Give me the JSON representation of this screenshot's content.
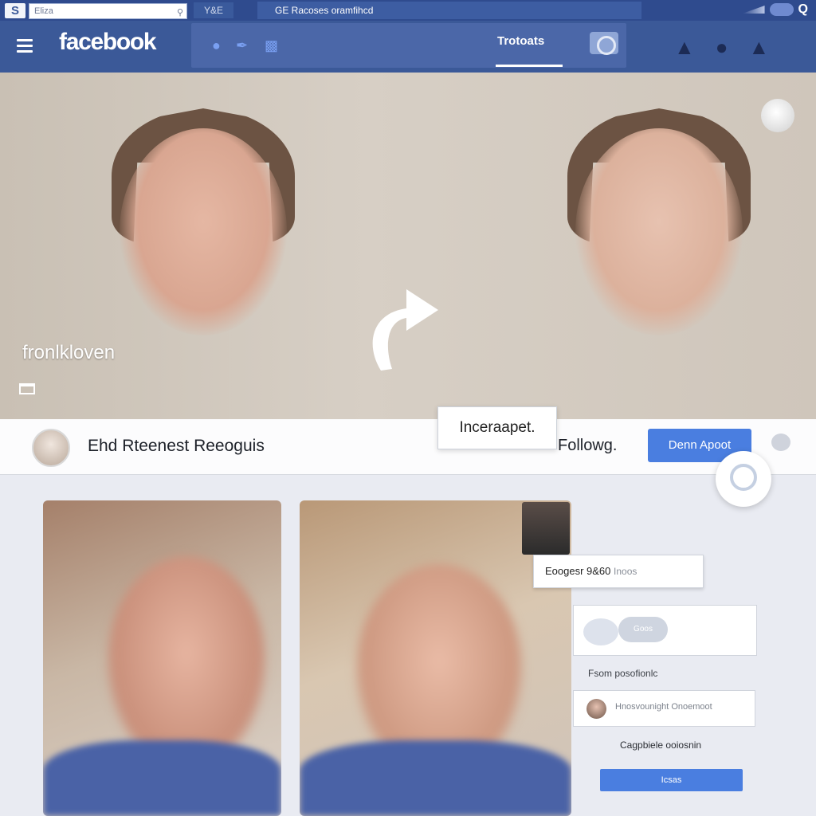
{
  "chrome": {
    "site_logo": "S",
    "search_value": "Eliza",
    "short_tab": "Y&E",
    "tab_title": "GE Racoses oramfihcd"
  },
  "header": {
    "logo": "facebook",
    "nav_label": "Trotoats"
  },
  "cover": {
    "overlay_name": "fronlkloven"
  },
  "profile": {
    "name": "Ehd Rteenest Reeoguis",
    "following_label": "Followg.",
    "primary_button": "Denn Apoot",
    "popup_label": "Inceraapet."
  },
  "sidebar": {
    "tooltip_text": "Eoogesr 9&60",
    "tooltip_muted": "Inoos",
    "react_pill": "Goos",
    "section_label": "Fsom posofionlc",
    "comment_text": "Hnosvounight Onoemoot",
    "caption": "Cagpbiele ooiosnin",
    "action_button": "Icsas"
  }
}
